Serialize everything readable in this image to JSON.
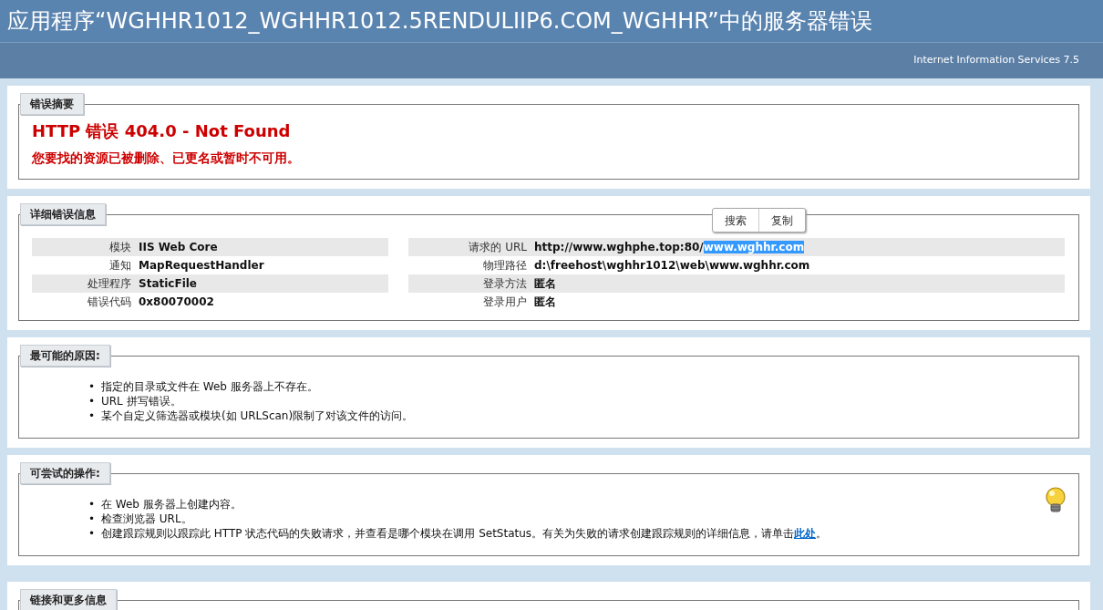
{
  "header": {
    "title": "应用程序“WGHHR1012_WGHHR1012.5RENDULIIP6.COM_WGHHR”中的服务器错误",
    "server": "Internet Information Services 7.5"
  },
  "summary": {
    "legend": "错误摘要",
    "heading": "HTTP 错误 404.0 - Not Found",
    "message": "您要找的资源已被删除、已更名或暂时不可用。"
  },
  "details": {
    "legend": "详细错误信息",
    "buttons": [
      "搜索",
      "复制"
    ],
    "left_rows": [
      {
        "label": "模块",
        "value": [
          {
            "text": "IIS Web Core",
            "selected": false
          }
        ]
      },
      {
        "label": "通知",
        "value": [
          {
            "text": "MapRequestHandler",
            "selected": false
          }
        ]
      },
      {
        "label": "处理程序",
        "value": [
          {
            "text": "StaticFile",
            "selected": false
          }
        ]
      },
      {
        "label": "错误代码",
        "value": [
          {
            "text": "0x80070002",
            "selected": false
          }
        ]
      }
    ],
    "right_rows": [
      {
        "label": "请求的 URL",
        "value": [
          {
            "text": "http://www.wghphe.top:80/",
            "selected": false
          },
          {
            "text": "www.wghhr.com",
            "selected": true
          }
        ]
      },
      {
        "label": "物理路径",
        "value": [
          {
            "text": "d:\\freehost\\wghhr1012\\web\\www.wghhr.com",
            "selected": false
          }
        ]
      },
      {
        "label": "登录方法",
        "value": [
          {
            "text": "匿名",
            "selected": false
          }
        ]
      },
      {
        "label": "登录用户",
        "value": [
          {
            "text": "匿名",
            "selected": false
          }
        ]
      }
    ]
  },
  "causes": {
    "legend": "最可能的原因:",
    "items": [
      {
        "marker": "•",
        "text": "指定的目录或文件在 Web 服务器上不存在。"
      },
      {
        "marker": "•",
        "text": "URL 拼写错误。"
      },
      {
        "marker": "•",
        "text": "某个自定义筛选器或模块(如 URLScan)限制了对该文件的访问。"
      }
    ]
  },
  "actions": {
    "legend": "可尝试的操作:",
    "items": [
      {
        "marker": "•",
        "text": "在 Web 服务器上创建内容。"
      },
      {
        "marker": "•",
        "text": "检查浏览器 URL。"
      },
      {
        "marker": "•",
        "text": "创建跟踪规则以跟踪此 HTTP 状态代码的失败请求，并查看是哪个模块在调用 SetStatus。有关为失败的请求创建跟踪规则的详细信息，请单击",
        "link": "此处",
        "after": "。"
      }
    ]
  },
  "links": {
    "legend": "链接和更多信息"
  }
}
